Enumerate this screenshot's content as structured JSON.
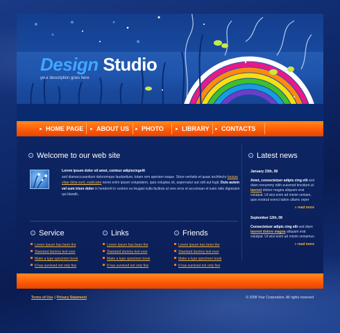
{
  "brand": {
    "name_part1": "Design",
    "name_part2": "Studio",
    "tagline": "your description goes here"
  },
  "nav": [
    {
      "label": "HOME PAGE"
    },
    {
      "label": "ABOUT US"
    },
    {
      "label": "PHOTO"
    },
    {
      "label": "LIBRARY"
    },
    {
      "label": "CONTACTS"
    }
  ],
  "welcome": {
    "title": "Welcome to our web site",
    "lead": "Lorem ipsum dolor sit amet, conteur adipiscingelit",
    "text1": "sed diamaccusantium doloremque laudantium, totam rem aperiam eaque. Store veritatis et quasi architecto",
    "link": "beatae vitae dicta sunt, explicabo",
    "text2": "nemo enim ipsam voluptatem, quia voluptas sit, aspernatur aut odit aut fugit.",
    "bold": "Duis autem vel eum iriure dolor",
    "text3": "in hendrerit in vvolore eu feugiat nulla facilisis at vero eros et accumsan et iusto odio dignissim qui blandit.."
  },
  "columns": [
    {
      "title": "Service",
      "items": [
        "Lorem Ipsum has been the",
        "Standard dummy text ever",
        "Make a type specimen book",
        "It has survived not only five"
      ]
    },
    {
      "title": "Links",
      "items": [
        "Lorem Ipsum has been the",
        "Standard dummy text ever",
        "Make a type specimen book",
        "It has survived not only five"
      ]
    },
    {
      "title": "Friends",
      "items": [
        "Lorem Ipsum has been the",
        "Standard dummy text ever",
        "Make a type specimen book",
        "It has survived not only five"
      ]
    }
  ],
  "news": {
    "title": "Latest news",
    "items": [
      {
        "date": "January 23th, 08",
        "title": "Amet, consectetuer adipis cing elit",
        "text_a": "sed diam nonummy nibh euismod tincidunt ut",
        "link": "laoreet",
        "text_b": "dolore magna aliquam erat volutpat.   Ut wisi enim ad minim veniam, quis nostrud exerci tation ullamc orper",
        "more": "read more"
      },
      {
        "date": "September 12th, 08",
        "title": "Consectetuer adipis cing elit",
        "text_a": "sed diam",
        "link": "laoreet dolore magna",
        "text_b": "aliquam erat volutpat.   Ut wisi enim ad minim veniamus",
        "more": "read more"
      }
    ]
  },
  "footer": {
    "terms": "Terms of Use",
    "sep": "|",
    "privacy": "Privacy Statement",
    "copyright": "© 2008 Your Corporation. All rights reserved"
  },
  "colors": {
    "accent": "#ff6a10",
    "link": "#f1b545",
    "bg": "#0b1d4e"
  }
}
